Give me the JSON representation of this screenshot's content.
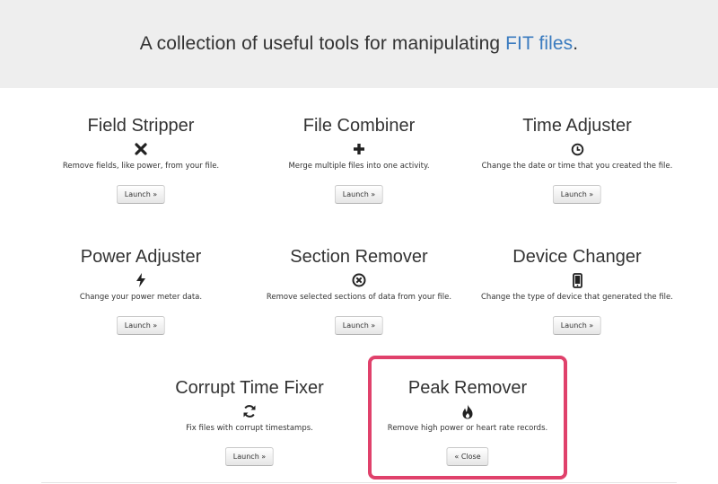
{
  "hero": {
    "text_before": "A collection of useful tools for manipulating ",
    "link_text": "FIT files",
    "text_after": "."
  },
  "tools": [
    {
      "title": "Field Stripper",
      "icon": "times-icon",
      "description": "Remove fields, like power, from your file.",
      "button": "Launch »"
    },
    {
      "title": "File Combiner",
      "icon": "plus-icon",
      "description": "Merge multiple files into one activity.",
      "button": "Launch »"
    },
    {
      "title": "Time Adjuster",
      "icon": "clock-icon",
      "description": "Change the date or time that you created the file.",
      "button": "Launch »"
    },
    {
      "title": "Power Adjuster",
      "icon": "bolt-icon",
      "description": "Change your power meter data.",
      "button": "Launch »"
    },
    {
      "title": "Section Remover",
      "icon": "remove-circle-icon",
      "description": "Remove selected sections of data from your file.",
      "button": "Launch »"
    },
    {
      "title": "Device Changer",
      "icon": "phone-icon",
      "description": "Change the type of device that generated the file.",
      "button": "Launch »"
    },
    {
      "title": "Corrupt Time Fixer",
      "icon": "refresh-icon",
      "description": "Fix files with corrupt timestamps.",
      "button": "Launch »"
    },
    {
      "title": "Peak Remover",
      "icon": "fire-icon",
      "description": "Remove high power or heart rate records.",
      "button": "« Close"
    }
  ],
  "colors": {
    "link": "#3a7bbf",
    "highlight": "#e0416b",
    "hero_bg": "#eeeeee"
  }
}
